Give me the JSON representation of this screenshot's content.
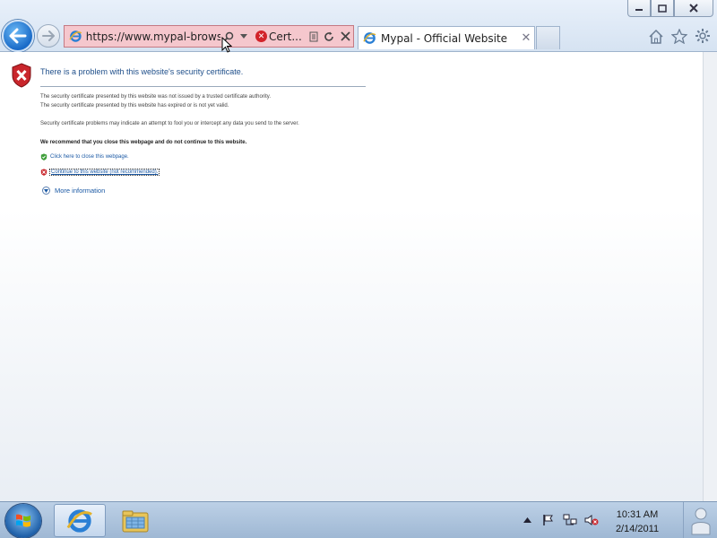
{
  "window": {
    "minimize_icon": "minimize-icon",
    "maximize_icon": "maximize-icon",
    "close_icon": "close-icon"
  },
  "navigation": {
    "address_url": "https://www.mypal-browser.c",
    "certificate_label": "Cert...",
    "tab_title": "Mypal - Official Website"
  },
  "page": {
    "title": "There is a problem with this website's security certificate.",
    "paragraph1_line1": "The security certificate presented by this website was not issued by a trusted certificate authority.",
    "paragraph1_line2": "The security certificate presented by this website has expired or is not yet valid.",
    "paragraph2": "Security certificate problems may indicate an attempt to fool you or intercept any data you send to the server.",
    "recommendation": "We recommend that you close this webpage and do not continue to this website.",
    "close_link": "Click here to close this webpage.",
    "continue_link": "Continue to this website (not recommended).",
    "more_information": "More information"
  },
  "taskbar": {
    "time": "10:31 AM",
    "date": "2/14/2011"
  },
  "colors": {
    "address_bar_error": "#f5c7cd",
    "link": "#1c5aa5",
    "title": "#1f4f8a"
  }
}
